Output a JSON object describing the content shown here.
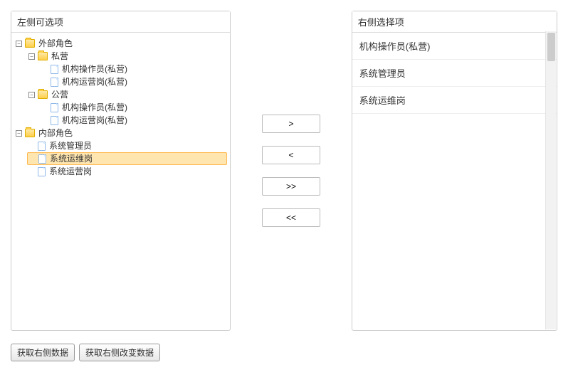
{
  "left": {
    "title": "左侧可选项",
    "tree": {
      "n0": {
        "label": "外部角色"
      },
      "n00": {
        "label": "私营"
      },
      "n000": {
        "label": "机构操作员(私营)"
      },
      "n001": {
        "label": "机构运营岗(私营)"
      },
      "n01": {
        "label": "公营"
      },
      "n010": {
        "label": "机构操作员(私营)"
      },
      "n011": {
        "label": "机构运营岗(私营)"
      },
      "n1": {
        "label": "内部角色"
      },
      "n10": {
        "label": "系统管理员"
      },
      "n11": {
        "label": "系统运维岗"
      },
      "n12": {
        "label": "系统运营岗"
      }
    }
  },
  "transfer": {
    "add": ">",
    "remove": "<",
    "addAll": ">>",
    "removeAll": "<<"
  },
  "right": {
    "title": "右侧选择项",
    "items": {
      "0": "机构操作员(私营)",
      "1": "系统管理员",
      "2": "系统运维岗"
    }
  },
  "actions": {
    "getRight": "获取右侧数据",
    "getRightChanged": "获取右侧改变数据"
  }
}
